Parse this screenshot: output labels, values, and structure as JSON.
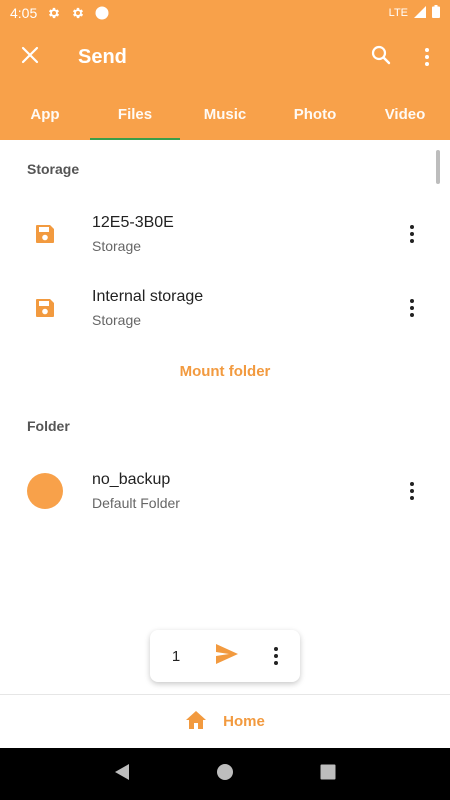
{
  "status_bar": {
    "time": "4:05",
    "network": "LTE",
    "icons": [
      "settings-icon",
      "settings-icon",
      "circle-notification-icon",
      "signal-icon",
      "battery-icon"
    ]
  },
  "toolbar": {
    "title": "Send",
    "close_icon": "close-icon",
    "search_icon": "search-icon",
    "menu_icon": "more-vert-icon"
  },
  "tabs": [
    {
      "label": "App",
      "active": false
    },
    {
      "label": "Files",
      "active": true
    },
    {
      "label": "Music",
      "active": false
    },
    {
      "label": "Photo",
      "active": false
    },
    {
      "label": "Video",
      "active": false
    }
  ],
  "storage_section": {
    "header": "Storage",
    "items": [
      {
        "name": "12E5-3B0E",
        "subtitle": "Storage",
        "icon": "sd-storage-icon"
      },
      {
        "name": "Internal storage",
        "subtitle": "Storage",
        "icon": "sd-storage-icon"
      }
    ],
    "mount_label": "Mount folder"
  },
  "folder_section": {
    "header": "Folder",
    "items": [
      {
        "name": "no_backup",
        "subtitle": "Default Folder",
        "icon": "folder-circle-icon"
      }
    ]
  },
  "selection_bar": {
    "count": "1",
    "send_icon": "send-icon",
    "more_icon": "more-vert-icon"
  },
  "bottom_nav": {
    "label": "Home",
    "icon": "home-icon"
  },
  "colors": {
    "accent": "#f8a14a",
    "accent_text": "#f29a3f",
    "tab_indicator": "#2e9e4a"
  }
}
